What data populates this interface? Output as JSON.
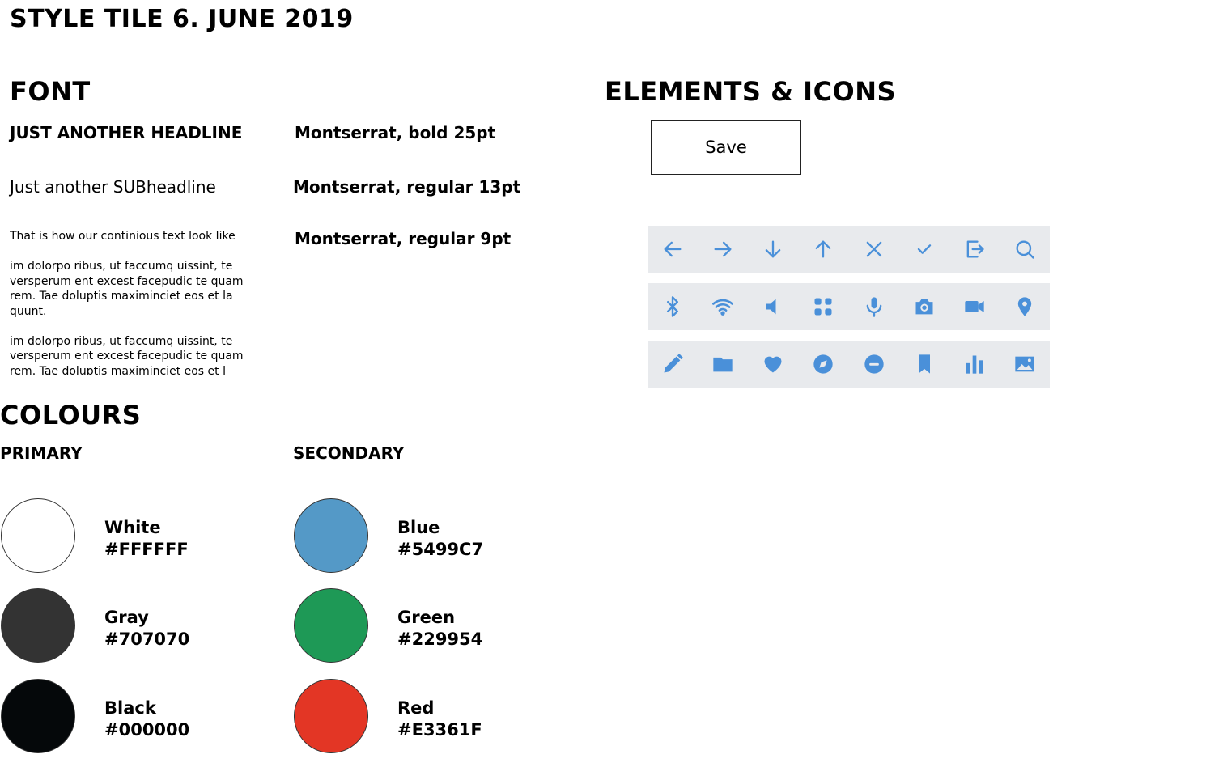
{
  "page_title": "STYLE TILE 6. JUNE 2019",
  "font_section": {
    "heading": "FONT",
    "samples": [
      {
        "sample": "JUST ANOTHER HEADLINE",
        "spec": "Montserrat, bold 25pt"
      },
      {
        "sample": "Just another SUBheadline",
        "spec": "Montserrat, regular 13pt"
      },
      {
        "sample": "That is how our continious text look like",
        "spec": "Montserrat, regular 9pt"
      }
    ],
    "body_paragraphs": [
      "im dolorpo ribus, ut faccumq uissint, te versperum ent excest facepudic te quam rem. Tae doluptis maximinciet eos et la quunt.",
      "im dolorpo ribus, ut faccumq uissint, te versperum ent excest facepudic te quam rem. Tae doluptis maximinciet eos et l"
    ]
  },
  "elements_section": {
    "heading": "ELEMENTS & ICONS",
    "save_button_label": "Save",
    "icon_color": "#4A90D9",
    "icon_bg": "#E8EAED",
    "icon_rows": [
      [
        "arrow-left-icon",
        "arrow-right-icon",
        "arrow-down-icon",
        "arrow-up-icon",
        "close-icon",
        "check-icon",
        "logout-icon",
        "search-icon"
      ],
      [
        "bluetooth-icon",
        "wifi-icon",
        "volume-icon",
        "apps-grid-icon",
        "microphone-icon",
        "camera-icon",
        "video-camera-icon",
        "location-pin-icon"
      ],
      [
        "pencil-icon",
        "folder-icon",
        "heart-icon",
        "compass-icon",
        "minus-circle-icon",
        "bookmark-icon",
        "bar-chart-icon",
        "image-icon"
      ]
    ]
  },
  "colours_section": {
    "heading": "COLOURS",
    "primary": {
      "label": "PRIMARY",
      "colors": [
        {
          "name": "White",
          "hex": "#FFFFFF",
          "fill": "#FFFFFF"
        },
        {
          "name": "Gray",
          "hex": "#707070",
          "fill": "#333333"
        },
        {
          "name": "Black",
          "hex": "#000000",
          "fill": "#05080A"
        }
      ]
    },
    "secondary": {
      "label": "SECONDARY",
      "colors": [
        {
          "name": "Blue",
          "hex": "#5499C7",
          "fill": "#5499C7"
        },
        {
          "name": "Green",
          "hex": "#229954",
          "fill": "#1E9956"
        },
        {
          "name": "Red",
          "hex": "#E3361F",
          "fill": "#E33625"
        }
      ]
    }
  }
}
